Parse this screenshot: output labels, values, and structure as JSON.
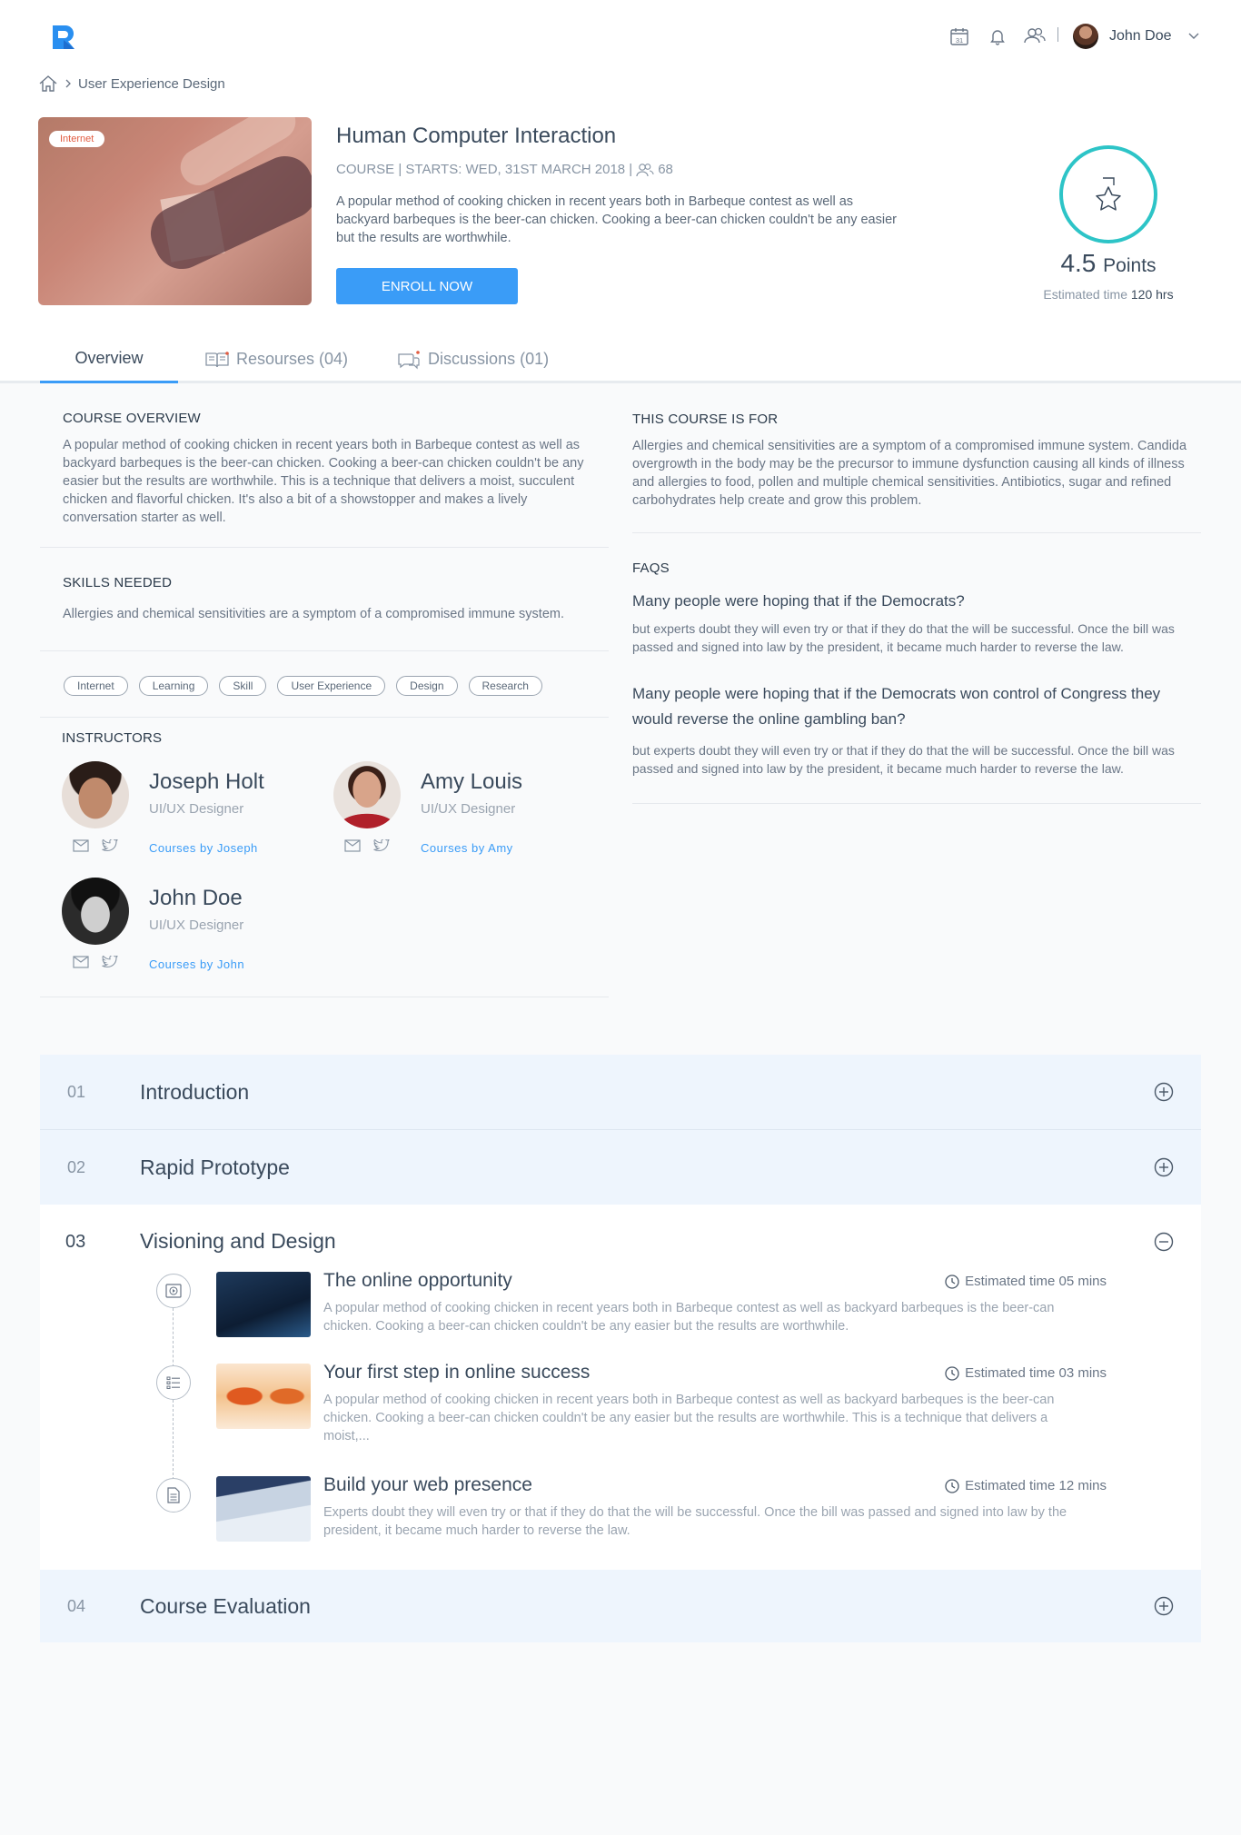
{
  "header": {
    "user_name": "John Doe",
    "calendar_day": "31"
  },
  "breadcrumb": {
    "current": "User Experience Design"
  },
  "course": {
    "image_tag": "Internet",
    "title": "Human Computer Interaction",
    "meta": "COURSE | STARTS: WED, 31ST MARCH 2018 |",
    "participants": "68",
    "description": "A popular method of cooking chicken in recent years both in Barbeque contest as well as backyard barbeques is the beer-can chicken. Cooking a beer-can chicken couldn't be any easier but the results are worthwhile.",
    "enroll_label": "ENROLL NOW",
    "points_value": "4.5",
    "points_label": "Points",
    "est_label": "Estimated time",
    "est_value": "120 hrs"
  },
  "tabs": [
    {
      "label": "Overview"
    },
    {
      "label": "Resourses (04)"
    },
    {
      "label": "Discussions (01)"
    }
  ],
  "overview": {
    "heading": "COURSE OVERVIEW",
    "text": "A popular method of cooking chicken in recent years both in Barbeque contest as well as backyard barbeques is the beer-can chicken. Cooking a beer-can chicken couldn't be any easier but the results are worthwhile. This is a technique that delivers a moist, succulent chicken and flavorful chicken. It's also a bit of a showstopper and makes a lively conversation starter as well."
  },
  "skills": {
    "heading": "SKILLS NEEDED",
    "text": "Allergies and chemical sensitivities are a symptom of a compromised immune system.",
    "tags": [
      "Internet",
      "Learning",
      "Skill",
      "User Experience",
      "Design",
      "Research"
    ]
  },
  "instructors": {
    "heading": "INSTRUCTORS",
    "list": [
      {
        "name": "Joseph Holt",
        "role": "UI/UX Designer",
        "link": "Courses by Joseph"
      },
      {
        "name": "Amy Louis",
        "role": "UI/UX Designer",
        "link": "Courses by Amy"
      },
      {
        "name": "John Doe",
        "role": "UI/UX Designer",
        "link": "Courses by John"
      }
    ]
  },
  "course_for": {
    "heading": "THIS COURSE IS FOR",
    "text": "Allergies and chemical sensitivities are a symptom of a compromised immune system. Candida overgrowth in the body may be the precursor to immune dysfunction causing all kinds of illness and allergies to food, pollen and multiple chemical sensitivities. Antibiotics, sugar and refined carbohydrates help create and grow this problem."
  },
  "faqs": {
    "heading": "FAQS",
    "items": [
      {
        "q": "Many people were hoping that if the Democrats?",
        "a": "but experts doubt they will even try or that if they do that the will be successful. Once the bill was passed and signed into law by the president, it became much harder to reverse the law."
      },
      {
        "q": "Many people were hoping that if the Democrats won control of Congress they would reverse the online gambling ban?",
        "a": "but experts doubt they will even try or that if they do that the will be successful. Once the bill was passed and signed into law by the president, it became much harder to reverse the law."
      }
    ]
  },
  "modules": [
    {
      "num": "01",
      "title": "Introduction"
    },
    {
      "num": "02",
      "title": "Rapid Prototype"
    },
    {
      "num": "03",
      "title": "Visioning and Design"
    },
    {
      "num": "04",
      "title": "Course Evaluation"
    }
  ],
  "lessons": [
    {
      "title": "The online opportunity",
      "time": "Estimated time 05 mins",
      "desc": "A popular method of cooking chicken in recent years both in Barbeque contest as well as backyard barbeques is the beer-can chicken. Cooking a beer-can chicken couldn't be any easier but the results are worthwhile."
    },
    {
      "title": "Your first step in online success",
      "time": "Estimated time 03 mins",
      "desc": "A popular method of cooking chicken in recent years both in Barbeque contest as well as backyard barbeques is the beer-can chicken. Cooking a beer-can chicken couldn't be any easier but the results are worthwhile. This is a technique that delivers a moist,..."
    },
    {
      "title": "Build your web presence",
      "time": "Estimated time 12 mins",
      "desc": "Experts doubt they will even try or that if they do that the will be successful. Once the bill was passed and signed into law by the president, it became much harder to reverse the law."
    }
  ],
  "colors": {
    "accent": "#3a9cf7",
    "ring": "#2dc4c7",
    "tag_text": "#e25d42",
    "accordion_bg": "#eef5fd"
  }
}
